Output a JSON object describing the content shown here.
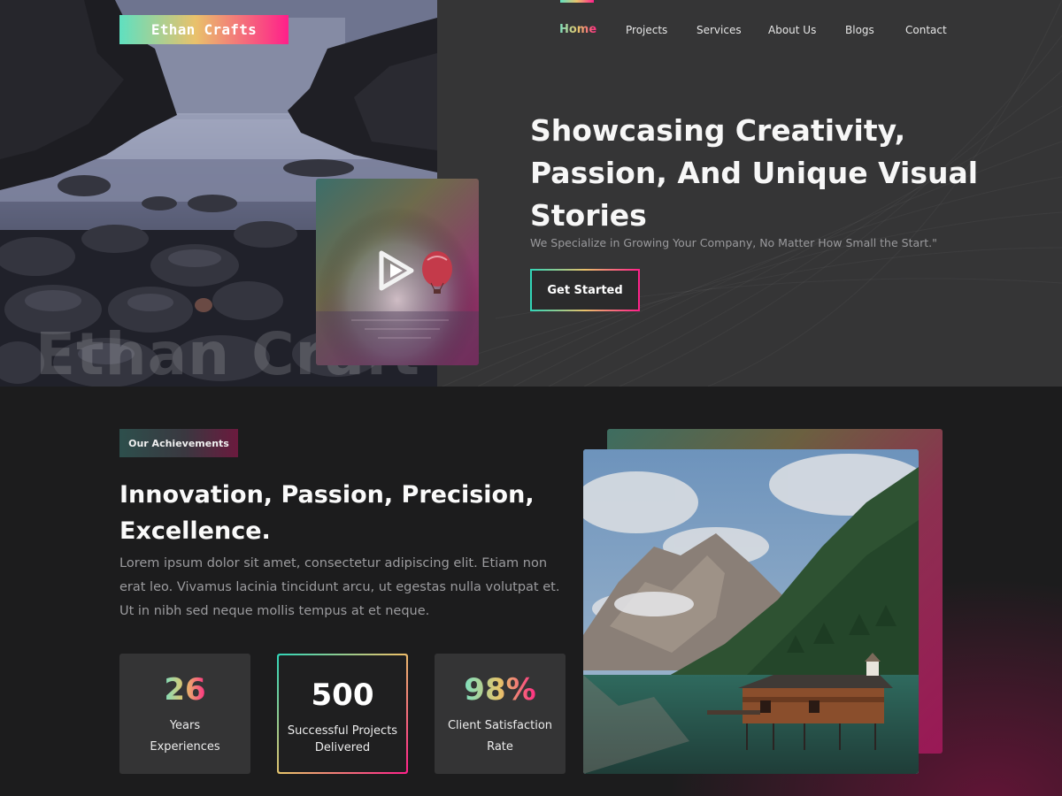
{
  "brand": {
    "logo_text": "Ethan Crafts",
    "watermark": "Ethan Craft"
  },
  "nav": {
    "items": [
      {
        "label": "Home",
        "active": true
      },
      {
        "label": "Projects",
        "active": false
      },
      {
        "label": "Services",
        "active": false
      },
      {
        "label": "About Us",
        "active": false
      },
      {
        "label": "Blogs",
        "active": false
      },
      {
        "label": "Contact",
        "active": false
      }
    ]
  },
  "hero": {
    "title": "Showcasing Creativity, Passion, And Unique Visual Stories",
    "subtitle": "We Specialize in Growing Your Company, No Matter How Small the Start.\"",
    "cta_label": "Get Started"
  },
  "achievements": {
    "badge": "Our Achievements",
    "title": "Innovation, Passion, Precision, Excellence.",
    "body": "Lorem ipsum dolor sit amet, consectetur adipiscing elit. Etiam non erat leo. Vivamus lacinia tincidunt arcu, ut egestas nulla volutpat et. Ut in nibh sed neque mollis tempus at et neque.",
    "stats": [
      {
        "value": "26",
        "label_line1": "Years",
        "label_line2": "Experiences"
      },
      {
        "value": "500",
        "label_line1": "Successful Projects",
        "label_line2": "Delivered"
      },
      {
        "value": "98%",
        "label_line1": "Client Satisfaction",
        "label_line2": "Rate"
      }
    ]
  },
  "colors": {
    "accent_teal": "#2fd6b9",
    "accent_gold": "#e9c16b",
    "accent_pink": "#ff1f8a",
    "hero_bg": "#353536",
    "section_bg": "#1c1c1d",
    "card_bg": "#343435"
  },
  "icons": {
    "play": "play-icon",
    "balloon": "hot-air-balloon"
  }
}
